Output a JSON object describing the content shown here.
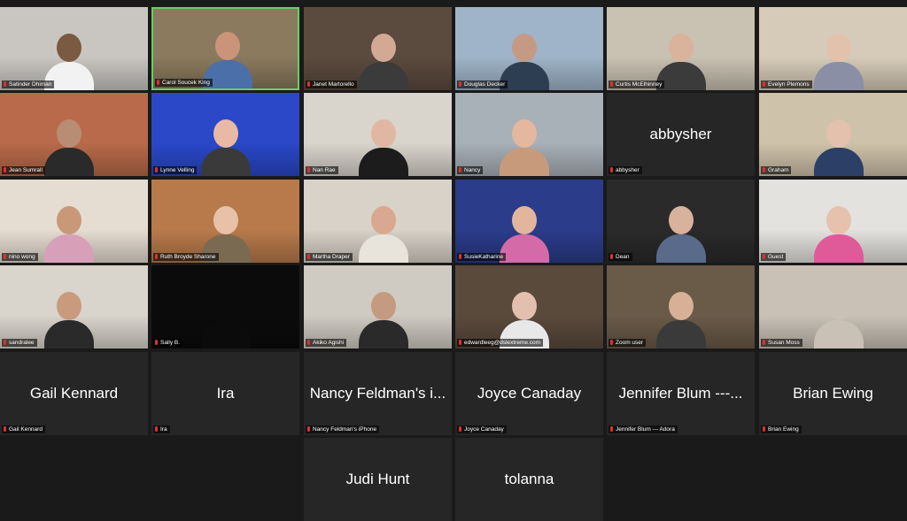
{
  "meeting": {
    "participants": [
      {
        "name": "Satinder Dhiman",
        "display": "",
        "video": true,
        "bg": "#c9c6c2",
        "skin": "#7a5a40",
        "shirt": "#f2f2f2"
      },
      {
        "name": "Carol Soucek King",
        "display": "",
        "video": true,
        "bg": "#8b7a5e",
        "skin": "#c9947a",
        "shirt": "#4b6fa8",
        "active": true
      },
      {
        "name": "Janet Martorello",
        "display": "",
        "video": true,
        "bg": "#5b4a3e",
        "skin": "#d3a894",
        "shirt": "#3b3b3b"
      },
      {
        "name": "Douglas Decker",
        "display": "",
        "video": true,
        "bg": "#9fb4c8",
        "skin": "#c49a84",
        "shirt": "#2e3e52"
      },
      {
        "name": "Curtis McElhinney",
        "display": "",
        "video": true,
        "bg": "#c9c1b2",
        "skin": "#d9b39b",
        "shirt": "#3b3b3b"
      },
      {
        "name": "Evelyn Plemons",
        "display": "",
        "video": true,
        "bg": "#d6cbb8",
        "skin": "#e2c2ad",
        "shirt": "#8a8fa6"
      },
      {
        "name": "Jean Sumrall",
        "display": "",
        "video": true,
        "bg": "#b86a4a",
        "skin": "#b98d74",
        "shirt": "#2a2a2a"
      },
      {
        "name": "Lynne Velling",
        "display": "",
        "video": true,
        "bg": "#2a48c8",
        "skin": "#e8b9a4",
        "shirt": "#3a3a3a"
      },
      {
        "name": "Nan Rae",
        "display": "",
        "video": true,
        "bg": "#d9d4cc",
        "skin": "#e0b7a2",
        "shirt": "#1c1c1c"
      },
      {
        "name": "Nancy",
        "display": "",
        "video": true,
        "bg": "#a8b0b8",
        "skin": "#e3b89e",
        "shirt": "#c89a7c"
      },
      {
        "name": "abbysher",
        "display": "abbysher",
        "video": false
      },
      {
        "name": "Graham",
        "display": "",
        "video": true,
        "bg": "#cfc2aa",
        "skin": "#e3c1ad",
        "shirt": "#2c3f66"
      },
      {
        "name": "nino wong",
        "display": "",
        "video": true,
        "bg": "#e6ddd2",
        "skin": "#c89878",
        "shirt": "#d8a0b8"
      },
      {
        "name": "Ruth Broyde Sharone",
        "display": "",
        "video": true,
        "bg": "#b87a4a",
        "skin": "#e7c2a8",
        "shirt": "#7a6a52"
      },
      {
        "name": "Martha Draper",
        "display": "",
        "video": true,
        "bg": "#d8d2c8",
        "skin": "#d9a890",
        "shirt": "#e8e4dc"
      },
      {
        "name": "SusieKatharine",
        "display": "",
        "video": true,
        "bg": "#2b3c8a",
        "skin": "#e2b59c",
        "shirt": "#d46aa8"
      },
      {
        "name": "Dean",
        "display": "",
        "video": true,
        "bg": "#2a2a2a",
        "skin": "#d8b29c",
        "shirt": "#5a6a8a"
      },
      {
        "name": "Guest",
        "display": "",
        "video": true,
        "bg": "#e4e2de",
        "skin": "#e6c1ae",
        "shirt": "#e05a9a"
      },
      {
        "name": "sandralee",
        "display": "",
        "video": true,
        "bg": "#d9d4cc",
        "skin": "#c99a7e",
        "shirt": "#2a2a2a"
      },
      {
        "name": "Sally B.",
        "display": "",
        "video": true,
        "bg": "#0b0b0b",
        "skin": "#0b0b0b",
        "shirt": "#0b0b0b"
      },
      {
        "name": "Akiko Agishi",
        "display": "",
        "video": true,
        "bg": "#cfcac2",
        "skin": "#c49a80",
        "shirt": "#2a2a2a"
      },
      {
        "name": "edwardleeg@dslextreme.com",
        "display": "",
        "video": true,
        "bg": "#5a4a3c",
        "skin": "#e2bfae",
        "shirt": "#e8e8e8"
      },
      {
        "name": "Zoom user",
        "display": "",
        "video": true,
        "bg": "#6a5a48",
        "skin": "#d8b098",
        "shirt": "#3a3a3a"
      },
      {
        "name": "Susan Moss",
        "display": "",
        "video": true,
        "bg": "#c9c1b6",
        "skin": "#c9c1b6",
        "shirt": "#c9c1b6"
      },
      {
        "name": "Gail Kennard",
        "display": "Gail Kennard",
        "video": false
      },
      {
        "name": "Ira",
        "display": "Ira",
        "video": false
      },
      {
        "name": "Nancy Feldman's iPhone",
        "display": "Nancy Feldman's i...",
        "video": false
      },
      {
        "name": "Joyce Canaday",
        "display": "Joyce Canaday",
        "video": false
      },
      {
        "name": "Jennifer Blum --- Adora",
        "display": "Jennifer Blum ---...",
        "video": false
      },
      {
        "name": "Brian Ewing",
        "display": "Brian Ewing",
        "video": false
      },
      {
        "name": "",
        "display": "Judi Hunt",
        "video": false,
        "nolabel": true
      },
      {
        "name": "",
        "display": "tolanna",
        "video": false,
        "nolabel": true
      }
    ]
  },
  "colors": {
    "background": "#1a1a1a",
    "tile": "#262626",
    "active_border": "#5fd35f",
    "muted_mic": "#e0302f"
  },
  "icons": {
    "muted": "microphone-muted-icon"
  }
}
